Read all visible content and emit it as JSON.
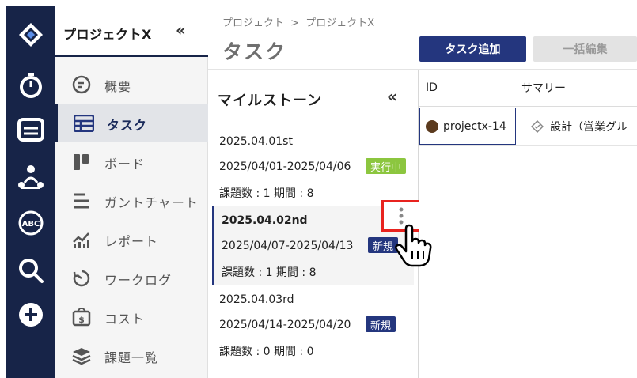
{
  "sidebar": {
    "project_name": "プロジェクトX",
    "collapse_icon": "«",
    "items": [
      {
        "label": "概要",
        "icon": "overview-icon"
      },
      {
        "label": "タスク",
        "icon": "task-table-icon",
        "active": true
      },
      {
        "label": "ボード",
        "icon": "board-icon"
      },
      {
        "label": "ガントチャート",
        "icon": "gantt-icon"
      },
      {
        "label": "レポート",
        "icon": "report-icon"
      },
      {
        "label": "ワークログ",
        "icon": "worklog-icon"
      },
      {
        "label": "コスト",
        "icon": "cost-icon"
      },
      {
        "label": "課題一覧",
        "icon": "issues-layers-icon"
      }
    ]
  },
  "rail": {
    "icons": [
      "logo-diamond-icon",
      "stopwatch-icon",
      "inbox-icon",
      "team-icon",
      "abc-icon",
      "search-icon",
      "add-icon"
    ]
  },
  "header": {
    "breadcrumb": [
      "プロジェクト",
      ">",
      "プロジェクトX"
    ],
    "title": "タスク",
    "add_task_button": "タスク追加",
    "bulk_edit_button": "一括編集"
  },
  "milestones": {
    "title": "マイルストーン",
    "collapse_icon": "«",
    "items": [
      {
        "name": "2025.04.01st",
        "range": "2025/04/01-2025/04/06",
        "status": "実行中",
        "meta": "課題数 : 1 期間 : 8"
      },
      {
        "name": "2025.04.02nd",
        "range": "2025/04/07-2025/04/13",
        "status": "新規",
        "meta": "課題数 : 1 期間 : 8",
        "selected": true
      },
      {
        "name": "2025.04.03rd",
        "range": "2025/04/14-2025/04/20",
        "status": "新規",
        "meta": "課題数 : 0 期間 : 0"
      }
    ]
  },
  "table": {
    "columns": [
      "ID",
      "サマリー"
    ],
    "rows": [
      {
        "id": "projectx-14",
        "summary": "設計（営業グル"
      }
    ]
  },
  "colors": {
    "navy": "#172448",
    "accent": "#24367e",
    "running_badge": "#8cc63f",
    "highlight": "#e8231f"
  }
}
